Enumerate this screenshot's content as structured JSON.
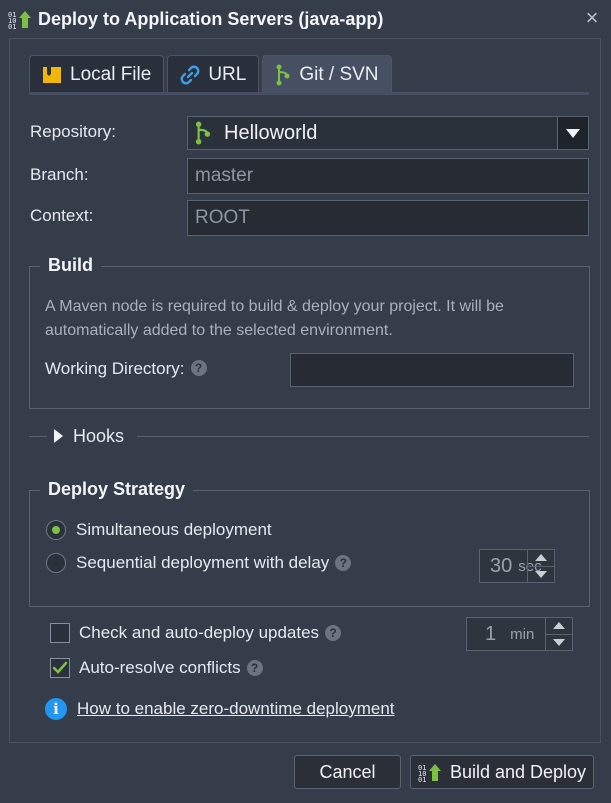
{
  "window": {
    "title": "Deploy to Application Servers (java-app)",
    "close_symbol": "×"
  },
  "tabs": [
    {
      "label": "Local File",
      "icon": "archive-icon",
      "active": false
    },
    {
      "label": "URL",
      "icon": "link-icon",
      "active": false
    },
    {
      "label": "Git / SVN",
      "icon": "git-branch-icon",
      "active": true
    }
  ],
  "form": {
    "repository_label": "Repository:",
    "repository_value": "Helloworld",
    "branch_label": "Branch:",
    "branch_value": "master",
    "context_label": "Context:",
    "context_value": "ROOT"
  },
  "build": {
    "legend": "Build",
    "description": "A Maven node is required to build & deploy your project. It will be automatically added to the selected environment.",
    "working_directory_label": "Working Directory:",
    "working_directory_value": ""
  },
  "hooks": {
    "label": "Hooks"
  },
  "deploy_strategy": {
    "legend": "Deploy Strategy",
    "options": [
      {
        "label": "Simultaneous deployment",
        "selected": true
      },
      {
        "label": "Sequential deployment with delay",
        "selected": false
      }
    ],
    "delay_value": "30",
    "delay_unit": "sec"
  },
  "options": {
    "auto_deploy_label": "Check and auto-deploy updates",
    "auto_deploy_checked": false,
    "interval_value": "1",
    "interval_unit": "min",
    "auto_resolve_label": "Auto-resolve conflicts",
    "auto_resolve_checked": true
  },
  "help_link": {
    "text": "How to enable zero-downtime deployment"
  },
  "footer": {
    "cancel_label": "Cancel",
    "build_deploy_label": "Build and Deploy"
  },
  "colors": {
    "background": "#353c4a",
    "accent_green": "#7cc144",
    "info_blue": "#2196f3",
    "tab_icon_yellow": "#f2b705",
    "tab_icon_blue": "#3a9fe8"
  }
}
